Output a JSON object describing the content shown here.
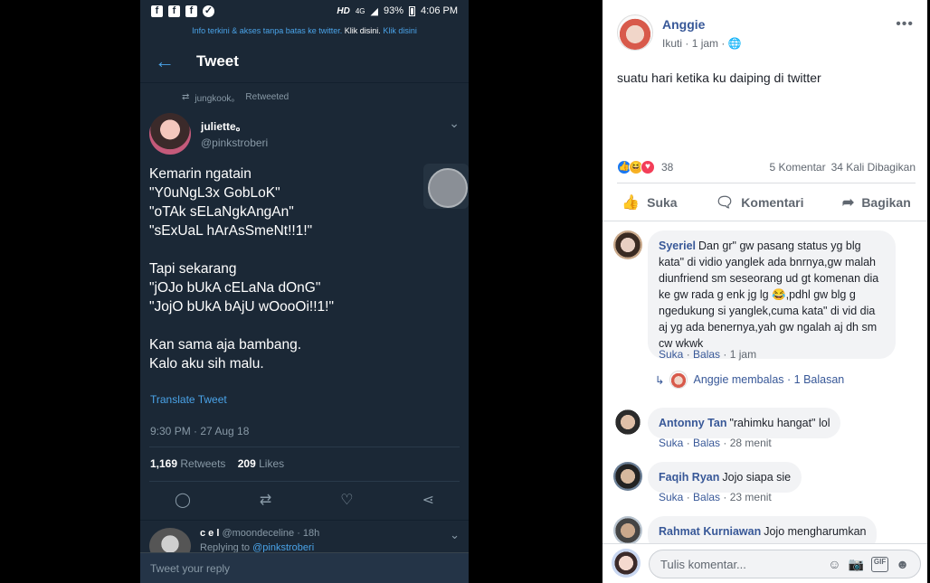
{
  "phone": {
    "status": {
      "hd": "HD",
      "network": "4G",
      "battery": "93%",
      "time": "4:06 PM"
    },
    "info_banner": {
      "text": "Info terkini & akses tanpa batas ke twitter.",
      "action1": "Klik disini.",
      "action2": "Klik disini"
    },
    "header": {
      "title": "Tweet"
    },
    "retweeted": {
      "user": "jungkook。",
      "label": "Retweeted"
    },
    "tweet": {
      "name": "juliette。",
      "handle": "@pinkstroberi",
      "body": "Kemarin ngatain\n\"Y0uNgL3x GobLoK\"\n\"oTAk sELaNgkAngAn\"\n\"sExUaL hArAsSmeNt!!1!\"\n\nTapi sekarang\n\"jOJo bUkA cELaNa dOnG\"\n\"JojO bUkA bAjU wOooOi!!1!\"\n\nKan sama aja bambang.\nKalo aku sih malu.",
      "translate": "Translate Tweet",
      "timestamp": "9:30 PM · 27 Aug 18",
      "retweets_count": "1,169",
      "retweets_label": "Retweets",
      "likes_count": "209",
      "likes_label": "Likes"
    },
    "reply_preview": {
      "name": "c e l",
      "handle": "@moondeceline",
      "age": "· 18h",
      "replying_prefix": "Replying to",
      "replying_to": "@pinkstroberi"
    },
    "compose": {
      "placeholder": "Tweet your reply"
    }
  },
  "fb": {
    "author": "Anggie",
    "follow": "Ikuti",
    "time": "· 1 jam ·",
    "text": "suatu hari ketika ku daiping di twitter",
    "reactions_count": "38",
    "comments_count": "5 Komentar",
    "shares_count": "34 Kali Dibagikan",
    "actions": {
      "like": "Suka",
      "comment": "Komentari",
      "share": "Bagikan"
    },
    "comments": [
      {
        "name": "Syeriel",
        "text": "Dan gr\" gw pasang status yg blg kata\" di vidio yanglek ada bnrnya,gw malah diunfriend sm seseorang ud gt komenan dia ke gw rada g enk jg lg 😂,pdhl gw blg g ngedukung si yanglek,cuma kata\" di vid dia aj yg ada benernya,yah gw ngalah aj dh sm cw wkwk",
        "like": "Suka",
        "reply": "Balas",
        "age": "1 jam",
        "reply_summary": "Anggie membalas · 1 Balasan"
      },
      {
        "name": "Antonny Tan",
        "text": "\"rahimku hangat\" lol",
        "like": "Suka",
        "reply": "Balas",
        "age": "28 menit"
      },
      {
        "name": "Faqih Ryan",
        "text": "Jojo siapa sie",
        "like": "Suka",
        "reply": "Balas",
        "age": "23 menit"
      },
      {
        "name": "Rahmat Kurniawan",
        "text": "Jojo mengharumkan"
      }
    ],
    "composer": {
      "placeholder": "Tulis komentar..."
    },
    "colors": {
      "link": "#385898",
      "like_blue": "#1877f2"
    }
  }
}
